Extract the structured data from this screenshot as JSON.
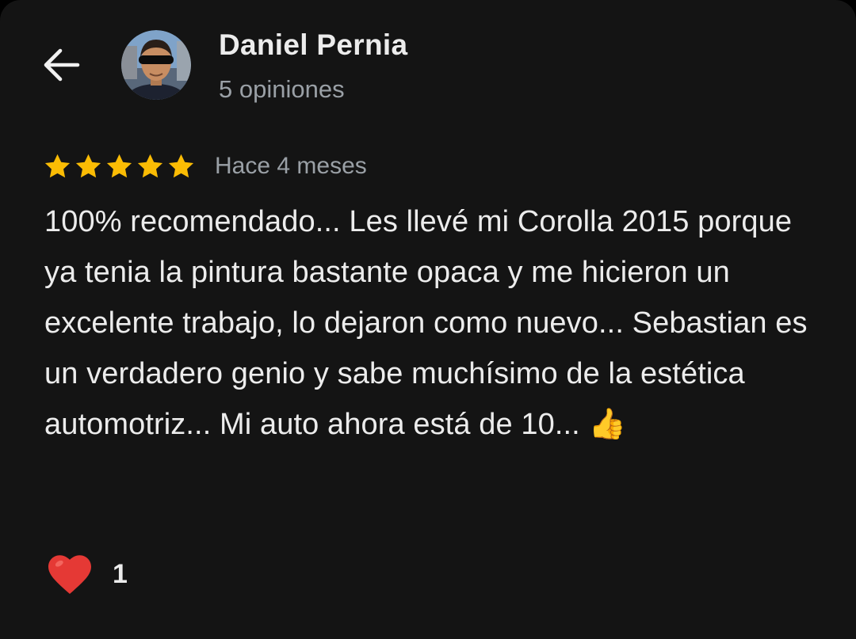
{
  "header": {
    "back_icon": "arrow-left-icon",
    "author_name": "Daniel Pernia",
    "author_meta": "5 opiniones"
  },
  "review": {
    "rating": 5,
    "rating_max": 5,
    "star_color": "#fbbc04",
    "date": "Hace 4 meses",
    "text": "100% recomendado... Les llevé mi Corolla 2015 porque ya tenia la pintura bastante opaca y me hicieron un excelente trabajo, lo dejaron como nuevo... Sebastian es un verdadero genio y sabe muchísimo de la estética automotriz... Mi auto ahora está de 10... 👍"
  },
  "reactions": {
    "icon": "heart-icon",
    "heart_color": "#e53935",
    "count": "1"
  },
  "theme": {
    "background": "#141414",
    "primary_text": "#ececec",
    "secondary_text": "#9aa0a6"
  }
}
